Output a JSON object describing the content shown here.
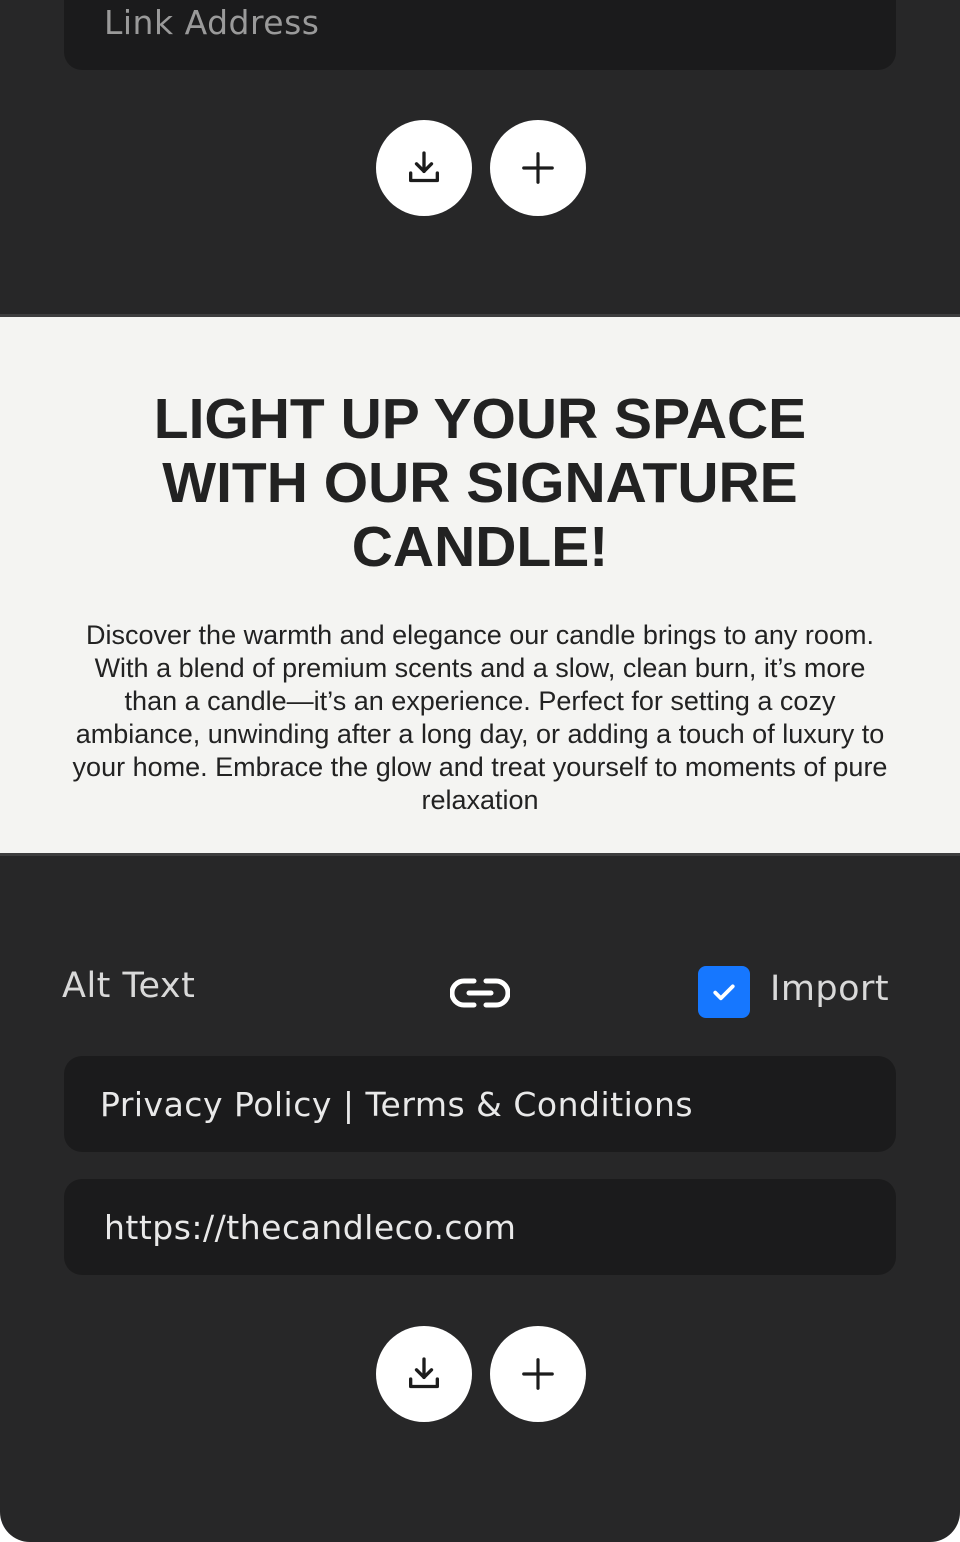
{
  "top_panel": {
    "link_field": {
      "placeholder": "Link Address"
    },
    "download_icon": "download-icon",
    "add_icon": "plus-icon"
  },
  "content_block": {
    "headline": "LIGHT UP YOUR SPACE WITH OUR SIGNATURE CANDLE!",
    "body": "Discover the warmth and elegance our candle brings to any room. With a blend of premium scents and a slow, clean burn, it’s more than a candle—it’s an experience. Perfect for setting a cozy ambiance, unwinding after a long day, or adding a touch of luxury to your home. Embrace the glow and treat yourself to moments of pure relaxation"
  },
  "bottom_panel": {
    "alt_text_label": "Alt Text",
    "link_icon": "link-icon",
    "import_checkbox": {
      "checked": true,
      "label": "Import"
    },
    "footer_text_field": {
      "value": "Privacy Policy | Terms & Conditions"
    },
    "url_field": {
      "value": "https://thecandleco.com"
    },
    "download_icon": "download-icon",
    "add_icon": "plus-icon"
  },
  "colors": {
    "panel_dark": "#272728",
    "field_dark": "#1b1b1c",
    "content_bg": "#f4f4f2",
    "accent_blue": "#1677ff",
    "button_bg": "#ffffff"
  }
}
